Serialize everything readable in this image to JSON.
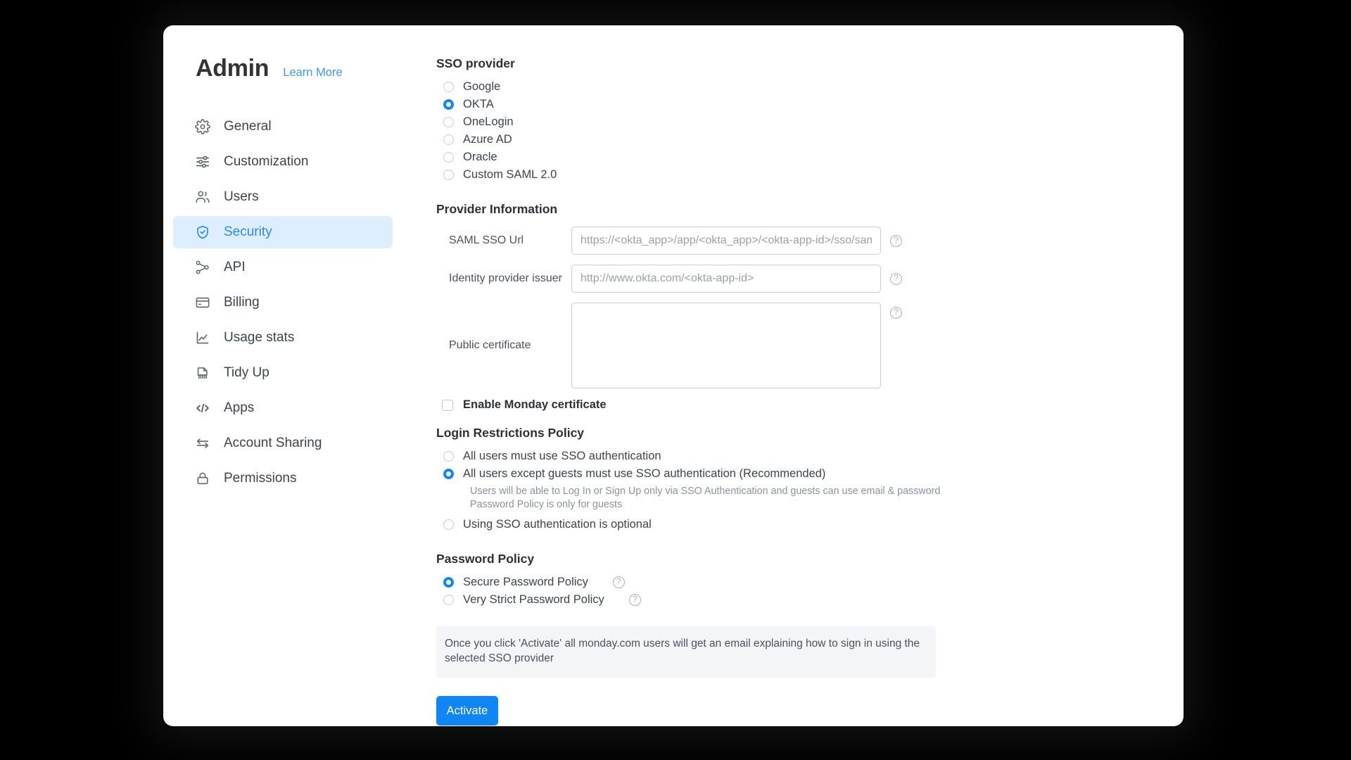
{
  "sidebar": {
    "title": "Admin",
    "learn_more": "Learn More",
    "items": [
      {
        "label": "General",
        "icon": "gear-icon",
        "selected": false
      },
      {
        "label": "Customization",
        "icon": "sliders-icon",
        "selected": false
      },
      {
        "label": "Users",
        "icon": "users-icon",
        "selected": false
      },
      {
        "label": "Security",
        "icon": "shield-check-icon",
        "selected": true
      },
      {
        "label": "API",
        "icon": "nodes-icon",
        "selected": false
      },
      {
        "label": "Billing",
        "icon": "credit-card-icon",
        "selected": false
      },
      {
        "label": "Usage stats",
        "icon": "chart-line-icon",
        "selected": false
      },
      {
        "label": "Tidy Up",
        "icon": "broom-icon",
        "selected": false
      },
      {
        "label": "Apps",
        "icon": "code-icon",
        "selected": false
      },
      {
        "label": "Account Sharing",
        "icon": "arrows-swap-icon",
        "selected": false
      },
      {
        "label": "Permissions",
        "icon": "lock-icon",
        "selected": false
      }
    ]
  },
  "sso_provider": {
    "title": "SSO provider",
    "options": [
      {
        "label": "Google",
        "selected": false
      },
      {
        "label": "OKTA",
        "selected": true
      },
      {
        "label": "OneLogin",
        "selected": false
      },
      {
        "label": "Azure AD",
        "selected": false
      },
      {
        "label": "Oracle",
        "selected": false
      },
      {
        "label": "Custom SAML 2.0",
        "selected": false
      }
    ]
  },
  "provider_information": {
    "title": "Provider Information",
    "saml_sso_url": {
      "label": "SAML SSO Url",
      "placeholder": "https://<okta_app>/app/<okta_app>/<okta-app-id>/sso/saml",
      "value": ""
    },
    "identity_provider_issuer": {
      "label": "Identity provider issuer",
      "placeholder": "http://www.okta.com/<okta-app-id>",
      "value": ""
    },
    "public_certificate": {
      "label": "Public certificate",
      "placeholder": "",
      "value": ""
    },
    "help_icon": "?",
    "enable_monday_certificate": {
      "label": "Enable Monday certificate",
      "checked": false
    }
  },
  "login_restrictions": {
    "title": "Login Restrictions Policy",
    "options": [
      {
        "label": "All users must use SSO authentication",
        "selected": false
      },
      {
        "label": "All users except guests must use SSO authentication (Recommended)",
        "selected": true
      },
      {
        "label": "Using SSO authentication is optional",
        "selected": false
      }
    ],
    "helper_line_1": "Users will be able to Log In or Sign Up only via SSO Authentication and guests can use email & password",
    "helper_line_2": "Password Policy is only for guests"
  },
  "password_policy": {
    "title": "Password Policy",
    "options": [
      {
        "label": "Secure Password Policy",
        "selected": true,
        "help": "?"
      },
      {
        "label": "Very Strict Password Policy",
        "selected": false,
        "help": "?"
      }
    ]
  },
  "banner": {
    "text": "Once you click 'Activate' all monday.com users will get an email explaining how to sign in using the selected SSO provider"
  },
  "activate_button": {
    "label": "Activate"
  },
  "colors": {
    "accent": "#0f86f5",
    "link": "#3d96f1",
    "selected_bg": "#ddeeff",
    "banner_bg": "#f4f5f7",
    "page_bg": "#000000",
    "card_bg": "#ffffff"
  }
}
